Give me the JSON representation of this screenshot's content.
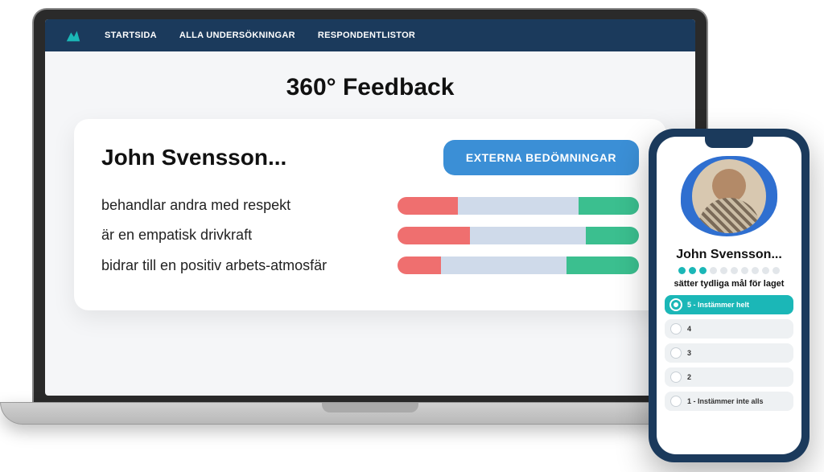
{
  "nav": {
    "links": [
      "STARTSIDA",
      "ALLA UNDERSÖKNINGAR",
      "RESPONDENTLISTOR"
    ]
  },
  "page": {
    "title": "360° Feedback"
  },
  "card": {
    "title": "John Svensson...",
    "badge": "EXTERNA BEDÖMNINGAR",
    "criteria": [
      {
        "label": "behandlar andra med respekt",
        "segments": [
          25,
          50,
          25
        ]
      },
      {
        "label": "är en empatisk drivkraft",
        "segments": [
          30,
          48,
          22
        ]
      },
      {
        "label": "bidrar till en positiv arbets-atmosfär",
        "segments": [
          18,
          52,
          30
        ]
      }
    ]
  },
  "phone": {
    "name": "John Svensson...",
    "progress_total": 10,
    "progress_done": 3,
    "question": "sätter tydliga mål för laget",
    "options": [
      {
        "label": "5 - Instämmer helt",
        "selected": true
      },
      {
        "label": "4",
        "selected": false
      },
      {
        "label": "3",
        "selected": false
      },
      {
        "label": "2",
        "selected": false
      },
      {
        "label": "1 - Instämmer inte alls",
        "selected": false
      }
    ]
  },
  "colors": {
    "navy": "#1b3a5c",
    "teal": "#1bb7b7",
    "blue": "#3b8fd6",
    "bar_red": "#ef6f6f",
    "bar_mid": "#cfdaea",
    "bar_green": "#3bbf8f"
  }
}
